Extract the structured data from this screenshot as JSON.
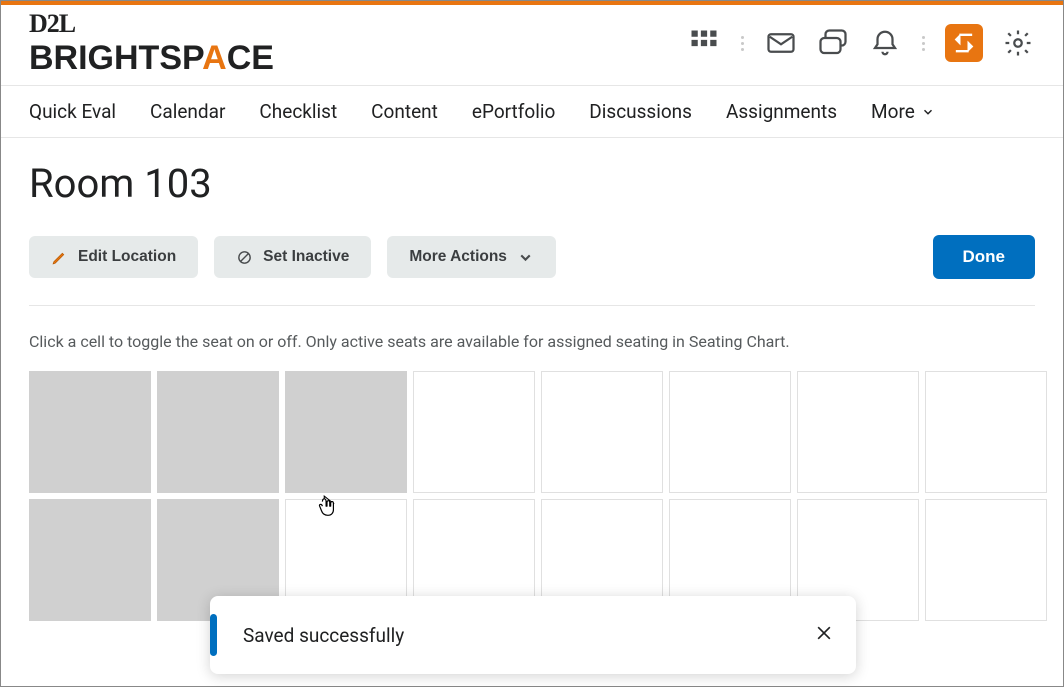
{
  "brand": {
    "top": "D2L",
    "bottom_pre": "BRIGHTSP",
    "bottom_a": "A",
    "bottom_post": "CE"
  },
  "nav": {
    "items": [
      "Quick Eval",
      "Calendar",
      "Checklist",
      "Content",
      "ePortfolio",
      "Discussions",
      "Assignments"
    ],
    "more": "More"
  },
  "page": {
    "title": "Room 103"
  },
  "toolbar": {
    "edit": "Edit Location",
    "inactive": "Set Inactive",
    "more": "More Actions",
    "done": "Done"
  },
  "instruction": "Click a cell to toggle the seat on or off. Only active seats are available for assigned seating in Seating Chart.",
  "seats": {
    "cols": 8,
    "rows": 2,
    "off_indices": [
      0,
      1,
      2,
      8,
      9
    ]
  },
  "toast": {
    "message": "Saved successfully"
  }
}
